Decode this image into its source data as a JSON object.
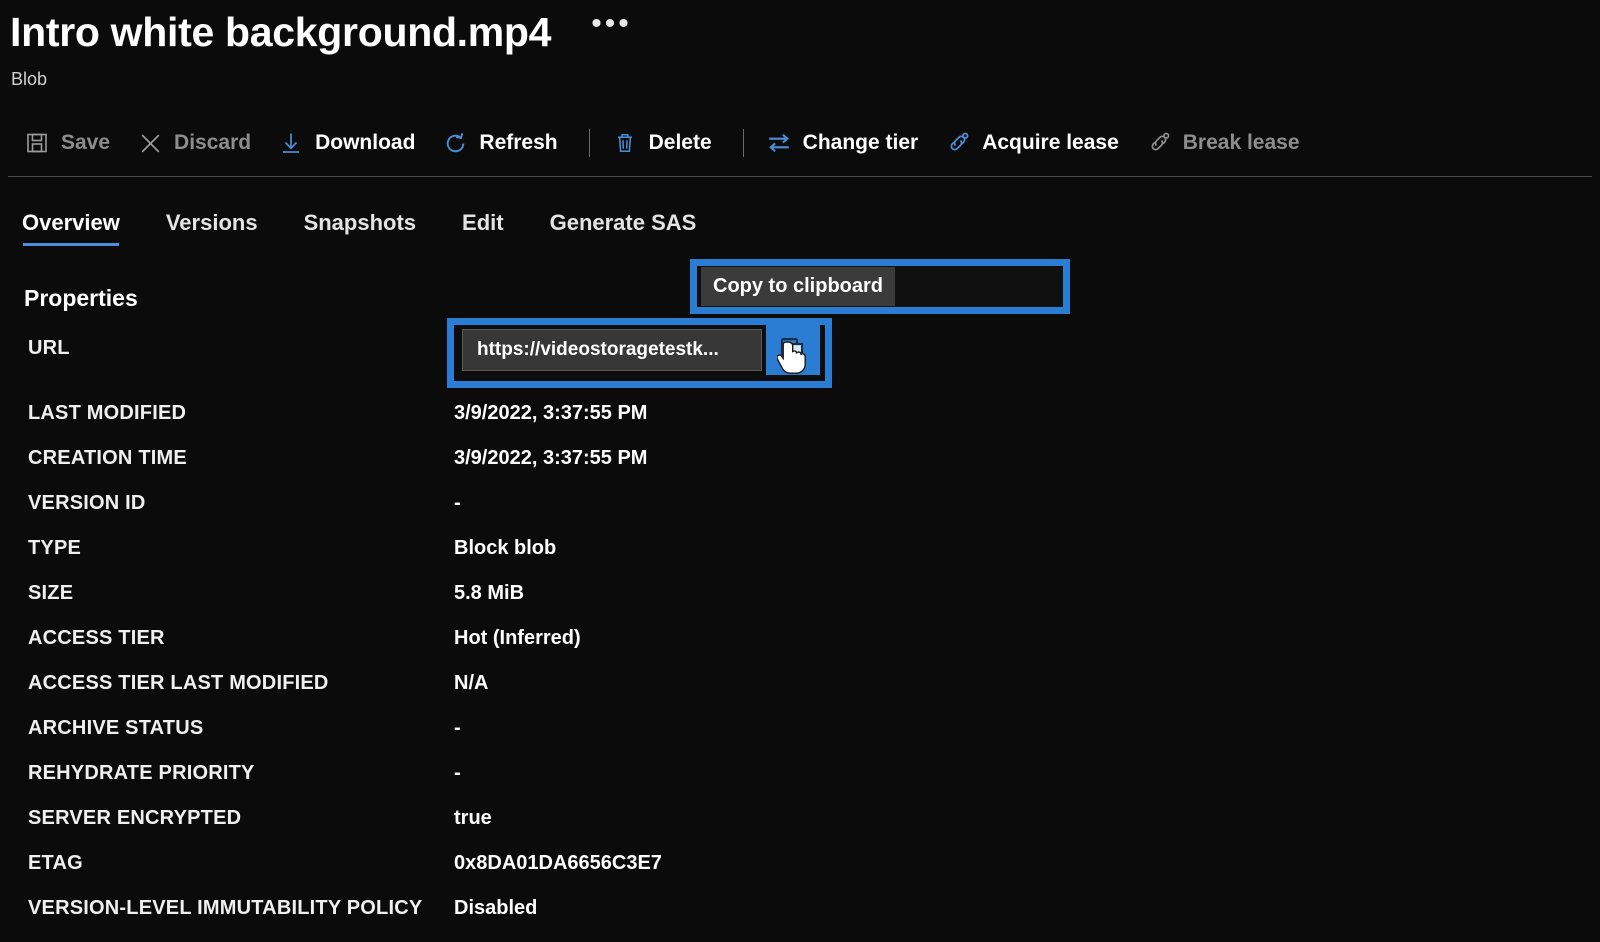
{
  "header": {
    "title": "Intro white background.mp4",
    "subtitle": "Blob",
    "more_label": "•••"
  },
  "toolbar": {
    "items": [
      {
        "label": "Save",
        "icon": "save-icon",
        "enabled": false
      },
      {
        "label": "Discard",
        "icon": "discard-icon",
        "enabled": false
      },
      {
        "label": "Download",
        "icon": "download-icon",
        "enabled": true
      },
      {
        "label": "Refresh",
        "icon": "refresh-icon",
        "enabled": true
      },
      {
        "label": "Delete",
        "icon": "delete-icon",
        "enabled": true
      },
      {
        "label": "Change tier",
        "icon": "change-tier-icon",
        "enabled": true
      },
      {
        "label": "Acquire lease",
        "icon": "acquire-lease-icon",
        "enabled": true
      },
      {
        "label": "Break lease",
        "icon": "break-lease-icon",
        "enabled": false
      }
    ]
  },
  "tabs": [
    {
      "label": "Overview",
      "active": true
    },
    {
      "label": "Versions",
      "active": false
    },
    {
      "label": "Snapshots",
      "active": false
    },
    {
      "label": "Edit",
      "active": false
    },
    {
      "label": "Generate SAS",
      "active": false
    }
  ],
  "properties": {
    "heading": "Properties",
    "rows": [
      {
        "key": "URL",
        "value": ""
      },
      {
        "key": "LAST MODIFIED",
        "value": "3/9/2022, 3:37:55 PM"
      },
      {
        "key": "CREATION TIME",
        "value": "3/9/2022, 3:37:55 PM"
      },
      {
        "key": "VERSION ID",
        "value": "-"
      },
      {
        "key": "TYPE",
        "value": "Block blob"
      },
      {
        "key": "SIZE",
        "value": "5.8 MiB"
      },
      {
        "key": "ACCESS TIER",
        "value": "Hot (Inferred)"
      },
      {
        "key": "ACCESS TIER LAST MODIFIED",
        "value": "N/A"
      },
      {
        "key": "ARCHIVE STATUS",
        "value": "-"
      },
      {
        "key": "REHYDRATE PRIORITY",
        "value": "-"
      },
      {
        "key": "SERVER ENCRYPTED",
        "value": "true"
      },
      {
        "key": "ETAG",
        "value": "0x8DA01DA6656C3E7"
      },
      {
        "key": "VERSION-LEVEL IMMUTABILITY POLICY",
        "value": "Disabled"
      }
    ]
  },
  "url_field": {
    "value": "https://videostoragetestk...",
    "copy_icon": "copy-to-clipboard-icon"
  },
  "tooltip": {
    "text": "Copy to clipboard"
  },
  "colors": {
    "accent_blue": "#2b7cd3",
    "tab_underline": "#4a90d9",
    "icon_blue": "#4a90d9",
    "background": "#0b0b0b",
    "input_background": "#373737",
    "tooltip_background": "#3b3b3b",
    "disabled_text": "#8d8d8d"
  }
}
